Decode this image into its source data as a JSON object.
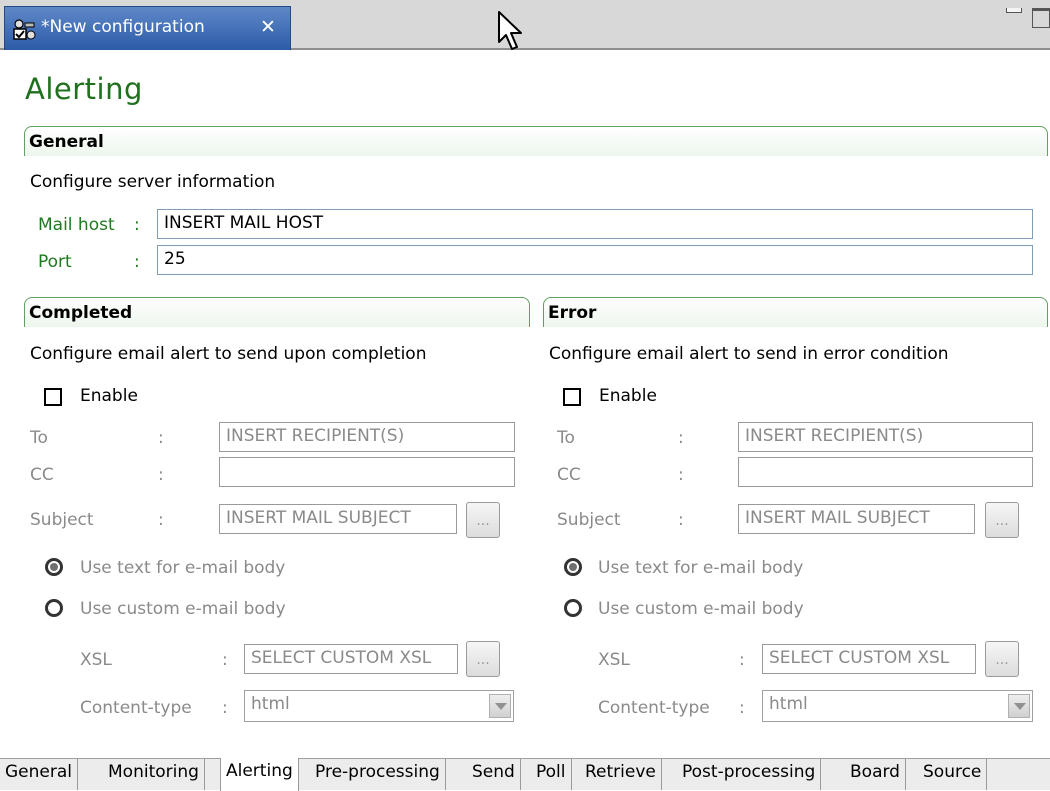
{
  "editor_tab": {
    "title": "*New configuration",
    "close_glyph": "✕",
    "icon": "configuration-icon"
  },
  "page_title": "Alerting",
  "general": {
    "header": "General",
    "description": "Configure server information",
    "mail_host_label": "Mail host",
    "mail_host_value": "INSERT MAIL HOST",
    "port_label": "Port",
    "port_value": "25",
    "colon": ":"
  },
  "completed": {
    "header": "Completed",
    "description": "Configure email alert to send upon completion",
    "enable_label": "Enable",
    "enable_checked": false,
    "to_label": "To",
    "to_value": "INSERT RECIPIENT(S)",
    "cc_label": "CC",
    "cc_value": "",
    "subject_label": "Subject",
    "subject_value": "INSERT MAIL SUBJECT",
    "browse_label": "...",
    "radio_text_label": "Use text for e-mail body",
    "radio_custom_label": "Use custom e-mail body",
    "selected_body": "text",
    "xsl_label": "XSL",
    "xsl_value": "SELECT CUSTOM XSL",
    "content_type_label": "Content-type",
    "content_type_value": "html",
    "colon": ":"
  },
  "error": {
    "header": "Error",
    "description": "Configure email alert to send in error condition",
    "enable_label": "Enable",
    "enable_checked": false,
    "to_label": "To",
    "to_value": "INSERT RECIPIENT(S)",
    "cc_label": "CC",
    "cc_value": "",
    "subject_label": "Subject",
    "subject_value": "INSERT MAIL SUBJECT",
    "browse_label": "...",
    "radio_text_label": "Use text for e-mail body",
    "radio_custom_label": "Use custom e-mail body",
    "selected_body": "text",
    "xsl_label": "XSL",
    "xsl_value": "SELECT CUSTOM XSL",
    "content_type_label": "Content-type",
    "content_type_value": "html",
    "colon": ":"
  },
  "bottom_tabs": [
    {
      "label": "General"
    },
    {
      "label": "Monitoring"
    },
    {
      "label": "Alerting",
      "active": true
    },
    {
      "label": "Pre-processing"
    },
    {
      "label": "Send"
    },
    {
      "label": "Poll"
    },
    {
      "label": "Retrieve"
    },
    {
      "label": "Post-processing"
    },
    {
      "label": "Board"
    },
    {
      "label": "Source"
    }
  ],
  "colors": {
    "accent_green": "#1f7a1f",
    "tab_blue": "#2c5ba8",
    "disabled_gray": "#8a8a8a"
  }
}
